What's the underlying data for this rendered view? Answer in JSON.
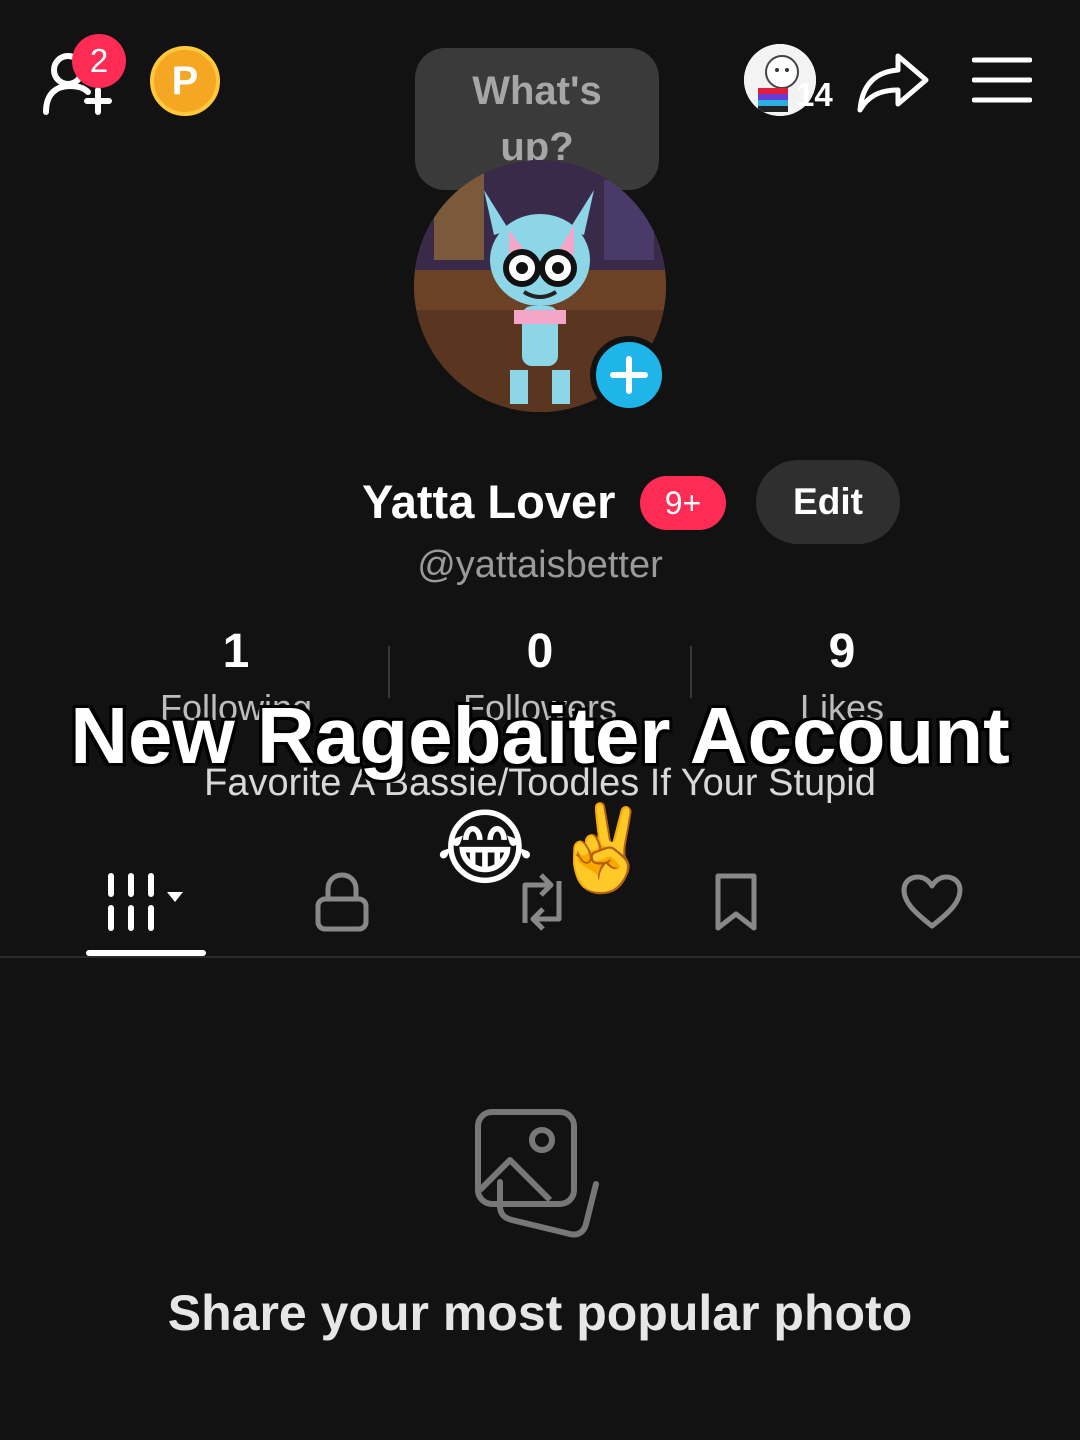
{
  "top_bar": {
    "friend_request_count": "2",
    "coin_letter": "P",
    "status_bubble": "What's up?",
    "viewer_count": "14"
  },
  "profile": {
    "display_name": "Yatta Lover",
    "notification_badge": "9+",
    "edit_label": "Edit",
    "username": "@yattaisbetter",
    "bio": "Favorite A Bassie/Toodles If Your Stupid"
  },
  "stats": [
    {
      "value": "1",
      "label": "Following"
    },
    {
      "value": "0",
      "label": "Followers"
    },
    {
      "value": "9",
      "label": "Likes"
    }
  ],
  "overlay": {
    "caption": "New Ragebaiter Account",
    "emoji_1": "😂",
    "emoji_2": "✌️"
  },
  "tabs": [
    {
      "icon": "grid-icon",
      "active": true
    },
    {
      "icon": "lock-icon",
      "active": false
    },
    {
      "icon": "repost-icon",
      "active": false
    },
    {
      "icon": "bookmark-icon",
      "active": false
    },
    {
      "icon": "heart-icon",
      "active": false
    }
  ],
  "empty_state": {
    "message": "Share your most popular photo"
  },
  "colors": {
    "background": "#121212",
    "accent_red": "#fe2c55",
    "accent_cyan": "#20b5e8",
    "coin": "#f5a623"
  }
}
